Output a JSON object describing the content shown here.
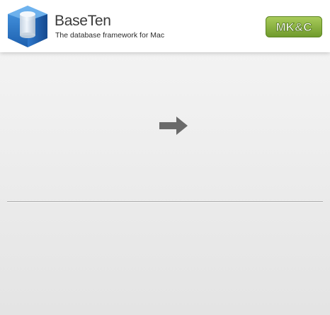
{
  "header": {
    "title": "BaseTen",
    "subtitle": "The database framework for Mac",
    "logo_icon": "database-cube-icon",
    "badge": {
      "text": "MK&C",
      "color": "#7aa236"
    }
  },
  "main": {
    "arrow_icon": "right-arrow-icon"
  },
  "colors": {
    "header_bg": "#ffffff",
    "body_bg": "#eeeeee",
    "arrow": "#6a6a6a",
    "divider": "#a9a9a9",
    "logo_blue": "#2f7fd0"
  }
}
